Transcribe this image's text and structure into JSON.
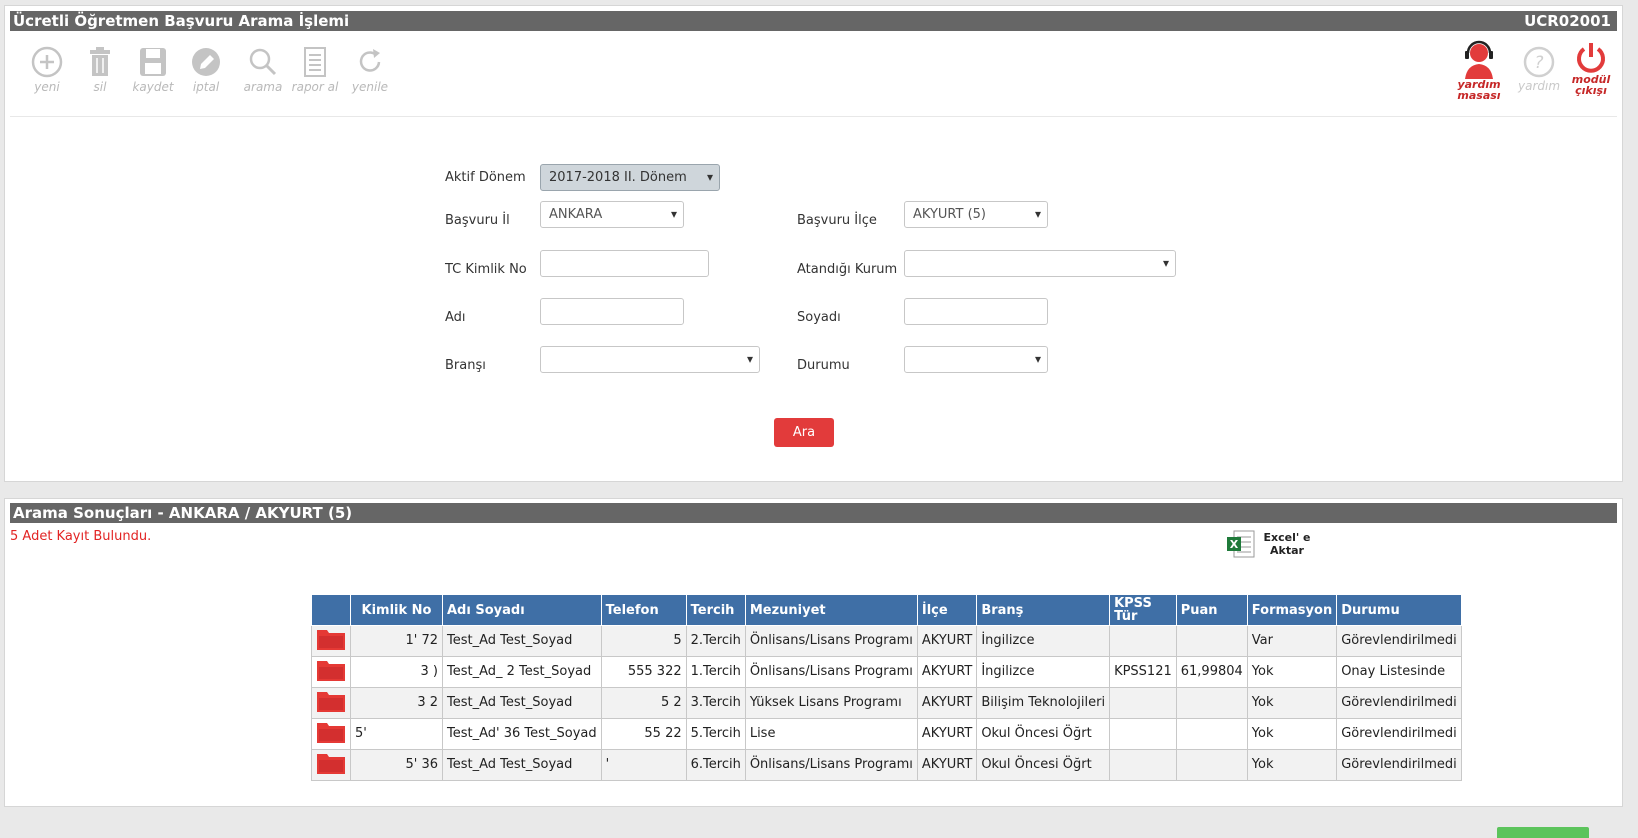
{
  "search_panel": {
    "title": "Ücretli Öğretmen Başvuru Arama İşlemi",
    "code": "UCR02001"
  },
  "toolbar": {
    "yeni": "yeni",
    "sil": "sil",
    "kaydet": "kaydet",
    "iptal": "iptal",
    "arama": "arama",
    "rapor_al": "rapor al",
    "yenile": "yenile"
  },
  "right_tools": {
    "yardim_masasi_line1": "yardım",
    "yardim_masasi_line2": "masası",
    "yardim": "yardım",
    "modul_cikisi_line1": "modül",
    "modul_cikisi_line2": "çıkışı",
    "colors": {
      "active": "#e23b3b",
      "disabled": "#c9c9c9"
    },
    "icons": [
      "headset-agent-icon",
      "help-circle-icon",
      "power-icon"
    ]
  },
  "form": {
    "aktif_donem": {
      "label": "Aktif Dönem",
      "value": "2017-2018 II. Dönem"
    },
    "basvuru_il": {
      "label": "Başvuru İl",
      "value": "ANKARA"
    },
    "basvuru_ilce": {
      "label": "Başvuru İlçe",
      "value": "AKYURT (5)"
    },
    "tc_kimlik": {
      "label": "TC Kimlik No",
      "value": ""
    },
    "atandigi_kurum": {
      "label": "Atandığı Kurum",
      "value": ""
    },
    "adi": {
      "label": "Adı",
      "value": ""
    },
    "soyadi": {
      "label": "Soyadı",
      "value": ""
    },
    "bransi": {
      "label": "Branşı",
      "value": ""
    },
    "durumu": {
      "label": "Durumu",
      "value": ""
    },
    "search_button": "Ara"
  },
  "results_panel": {
    "title": "Arama Sonuçları  - ANKARA / AKYURT (5)",
    "found_text": "5 Adet Kayıt Bulundu.",
    "excel_line1": "Excel' e",
    "excel_line2": "Aktar",
    "columns": [
      "",
      "Kimlik No",
      "Adı Soyadı",
      "Telefon",
      "Tercih",
      "Mezuniyet",
      "İlçe",
      "Branş",
      "KPSS Tür",
      "Puan",
      "Formasyon",
      "Durumu"
    ],
    "rows": [
      {
        "kimlik": "1'          72",
        "ad": "Test_Ad Test_Soyad",
        "telefon": "5",
        "tercih": "2.Tercih",
        "mezuniyet": "Önlisans/Lisans Programı",
        "ilce": "AKYURT",
        "brans": "İngilizce",
        "kpss": "",
        "puan": "",
        "formasyon": "Var",
        "durum": "Görevlendirilmedi"
      },
      {
        "kimlik": "3          )",
        "ad": "Test_Ad_          2 Test_Soyad",
        "telefon": "555        322",
        "tercih": "1.Tercih",
        "mezuniyet": "Önlisans/Lisans Programı",
        "ilce": "AKYURT",
        "brans": "İngilizce",
        "kpss": "KPSS121",
        "puan": "61,99804",
        "formasyon": "Yok",
        "durum": "Onay Listesinde"
      },
      {
        "kimlik": "3          2",
        "ad": "Test_Ad Test_Soyad",
        "telefon": "5          2",
        "tercih": "3.Tercih",
        "mezuniyet": "Yüksek Lisans Programı",
        "ilce": "AKYURT",
        "brans": "Bilişim Teknolojileri",
        "kpss": "",
        "puan": "",
        "formasyon": "Yok",
        "durum": "Görevlendirilmedi"
      },
      {
        "kimlik": "5'",
        "ad": "Test_Ad'          36 Test_Soyad",
        "telefon": "55        22",
        "tercih": "5.Tercih",
        "mezuniyet": "Lise",
        "ilce": "AKYURT",
        "brans": "Okul Öncesi Öğrt",
        "kpss": "",
        "puan": "",
        "formasyon": "Yok",
        "durum": "Görevlendirilmedi"
      },
      {
        "kimlik": "5'          36",
        "ad": "Test_Ad Test_Soyad",
        "telefon": "'",
        "tercih": "6.Tercih",
        "mezuniyet": "Önlisans/Lisans Programı",
        "ilce": "AKYURT",
        "brans": "Okul Öncesi Öğrt",
        "kpss": "",
        "puan": "",
        "formasyon": "Yok",
        "durum": "Görevlendirilmedi"
      }
    ]
  }
}
